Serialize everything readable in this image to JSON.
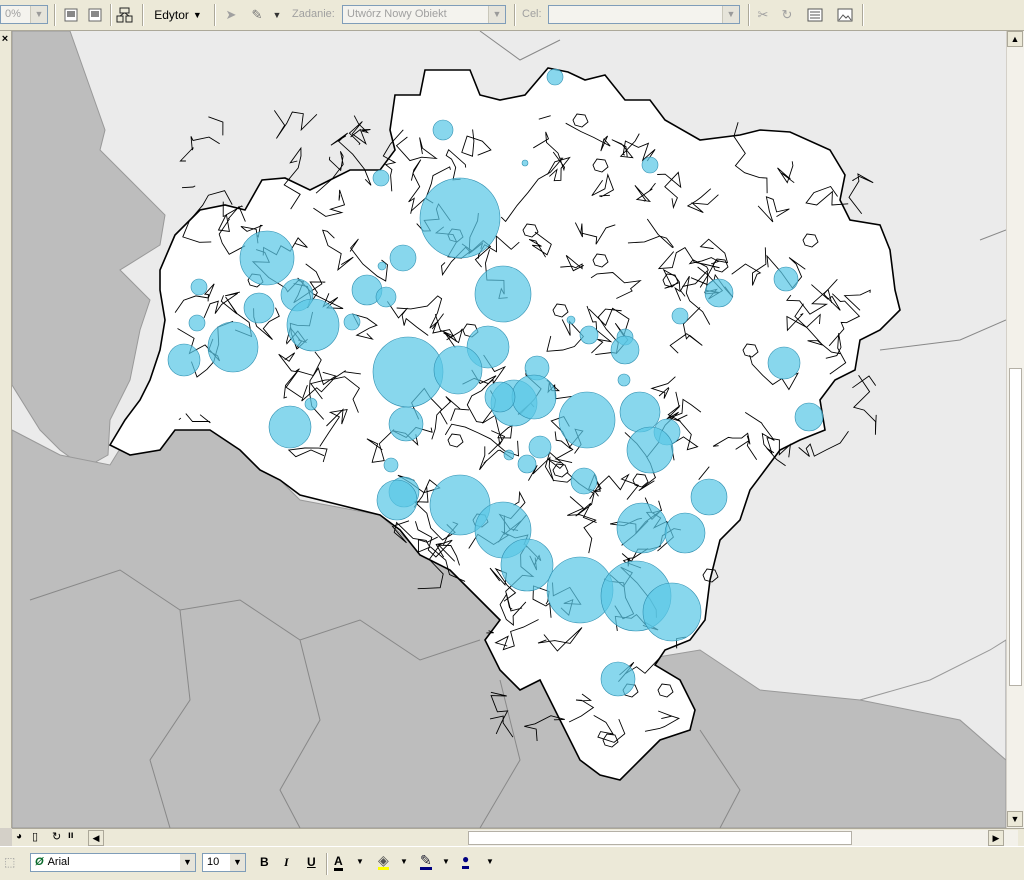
{
  "toolbar": {
    "zoom_value": "0%",
    "editor_label": "Edytor",
    "task_label": "Zadanie:",
    "task_value": "Utwórz Nowy Obiekt",
    "target_label": "Cel:",
    "target_value": ""
  },
  "left_panel": {
    "close_glyph": "×"
  },
  "map": {
    "colors": {
      "outside_land": "#bdbdbd",
      "background": "#ebebeb",
      "region_fill": "#ffffff",
      "circle_fill": "#5ac8e6",
      "boundary": "#000000"
    },
    "symbols": "proportional-circles"
  },
  "font_bar": {
    "font_name": "Arial",
    "font_size": "10",
    "bold": "B",
    "italic": "I",
    "underline": "U",
    "font_color_glyph": "A"
  },
  "icons": [
    "combo-arrow-icon",
    "layout-icon",
    "grid-icon",
    "network-icon",
    "select-arrow-icon",
    "pencil-icon",
    "split-icon",
    "rotate-icon",
    "attributes-icon",
    "image-icon",
    "globe-icon",
    "page-icon",
    "refresh-icon",
    "pause-icon",
    "fill-bucket-icon",
    "line-color-icon",
    "marker-icon"
  ]
}
